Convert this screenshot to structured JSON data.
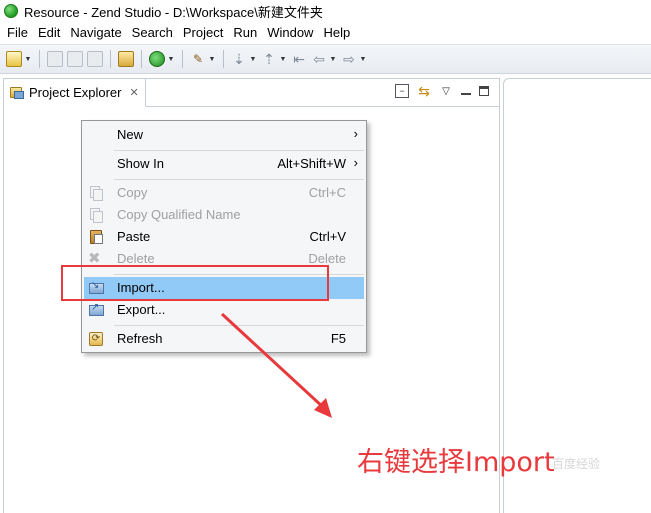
{
  "window": {
    "title": "Resource - Zend Studio - D:\\Workspace\\新建文件夹"
  },
  "menubar": {
    "items": [
      "File",
      "Edit",
      "Navigate",
      "Search",
      "Project",
      "Run",
      "Window",
      "Help"
    ]
  },
  "toolbar": {
    "icons": [
      "new-icon",
      "save-icon",
      "save-all-icon",
      "print-icon",
      "open-type-icon",
      "run-icon",
      "tools-icon",
      "next-annotation-icon",
      "prev-annotation-icon",
      "back-icon",
      "forward-icon"
    ]
  },
  "project_explorer": {
    "tab_label": "Project Explorer",
    "close_glyph": "✕"
  },
  "context_menu": {
    "items": [
      {
        "label": "New",
        "accelerator": "",
        "submenu": true,
        "disabled": false,
        "icon": ""
      },
      {
        "label": "Show In",
        "accelerator": "Alt+Shift+W",
        "submenu": true,
        "disabled": false,
        "icon": ""
      },
      {
        "label": "Copy",
        "accelerator": "Ctrl+C",
        "submenu": false,
        "disabled": true,
        "icon": "copy-icon"
      },
      {
        "label": "Copy Qualified Name",
        "accelerator": "",
        "submenu": false,
        "disabled": true,
        "icon": "copy-qualified-name-icon"
      },
      {
        "label": "Paste",
        "accelerator": "Ctrl+V",
        "submenu": false,
        "disabled": false,
        "icon": "paste-icon"
      },
      {
        "label": "Delete",
        "accelerator": "Delete",
        "submenu": false,
        "disabled": true,
        "icon": "delete-icon"
      },
      {
        "label": "Import...",
        "accelerator": "",
        "submenu": false,
        "disabled": false,
        "icon": "import-icon",
        "highlighted": true
      },
      {
        "label": "Export...",
        "accelerator": "",
        "submenu": false,
        "disabled": false,
        "icon": "export-icon"
      },
      {
        "label": "Refresh",
        "accelerator": "F5",
        "submenu": false,
        "disabled": false,
        "icon": "refresh-icon"
      }
    ],
    "submenu_glyph": "›"
  },
  "annotation": {
    "text": "右键选择Import",
    "color": "#e8393d"
  },
  "watermark": {
    "text": "百度经验"
  },
  "colors": {
    "highlight": "#91c9f7",
    "annotation_red": "#e8393d",
    "menu_bg": "#f5f6f7"
  }
}
